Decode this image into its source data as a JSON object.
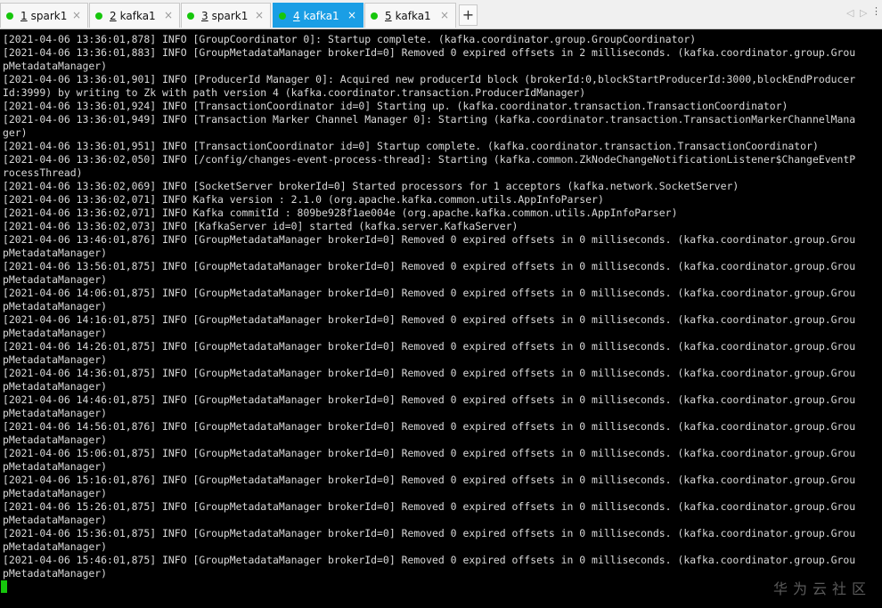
{
  "tabs": [
    {
      "num": "1",
      "name": "spark1",
      "close": "×"
    },
    {
      "num": "2",
      "name": "kafka1",
      "close": "×"
    },
    {
      "num": "3",
      "name": "spark1",
      "close": "×"
    },
    {
      "num": "4",
      "name": "kafka1",
      "close": "×"
    },
    {
      "num": "5",
      "name": "kafka1",
      "close": "×"
    }
  ],
  "add_tab": "+",
  "nav": {
    "left": "◁",
    "right": "▷",
    "menu": "⋮"
  },
  "terminal_lines": [
    "[2021-04-06 13:36:01,878] INFO [GroupCoordinator 0]: Startup complete. (kafka.coordinator.group.GroupCoordinator)",
    "[2021-04-06 13:36:01,883] INFO [GroupMetadataManager brokerId=0] Removed 0 expired offsets in 2 milliseconds. (kafka.coordinator.group.Grou",
    "pMetadataManager)",
    "[2021-04-06 13:36:01,901] INFO [ProducerId Manager 0]: Acquired new producerId block (brokerId:0,blockStartProducerId:3000,blockEndProducer",
    "Id:3999) by writing to Zk with path version 4 (kafka.coordinator.transaction.ProducerIdManager)",
    "[2021-04-06 13:36:01,924] INFO [TransactionCoordinator id=0] Starting up. (kafka.coordinator.transaction.TransactionCoordinator)",
    "[2021-04-06 13:36:01,949] INFO [Transaction Marker Channel Manager 0]: Starting (kafka.coordinator.transaction.TransactionMarkerChannelMana",
    "ger)",
    "[2021-04-06 13:36:01,951] INFO [TransactionCoordinator id=0] Startup complete. (kafka.coordinator.transaction.TransactionCoordinator)",
    "[2021-04-06 13:36:02,050] INFO [/config/changes-event-process-thread]: Starting (kafka.common.ZkNodeChangeNotificationListener$ChangeEventP",
    "rocessThread)",
    "[2021-04-06 13:36:02,069] INFO [SocketServer brokerId=0] Started processors for 1 acceptors (kafka.network.SocketServer)",
    "[2021-04-06 13:36:02,071] INFO Kafka version : 2.1.0 (org.apache.kafka.common.utils.AppInfoParser)",
    "[2021-04-06 13:36:02,071] INFO Kafka commitId : 809be928f1ae004e (org.apache.kafka.common.utils.AppInfoParser)",
    "[2021-04-06 13:36:02,073] INFO [KafkaServer id=0] started (kafka.server.KafkaServer)",
    "[2021-04-06 13:46:01,876] INFO [GroupMetadataManager brokerId=0] Removed 0 expired offsets in 0 milliseconds. (kafka.coordinator.group.Grou",
    "pMetadataManager)",
    "[2021-04-06 13:56:01,875] INFO [GroupMetadataManager brokerId=0] Removed 0 expired offsets in 0 milliseconds. (kafka.coordinator.group.Grou",
    "pMetadataManager)",
    "[2021-04-06 14:06:01,875] INFO [GroupMetadataManager brokerId=0] Removed 0 expired offsets in 0 milliseconds. (kafka.coordinator.group.Grou",
    "pMetadataManager)",
    "[2021-04-06 14:16:01,875] INFO [GroupMetadataManager brokerId=0] Removed 0 expired offsets in 0 milliseconds. (kafka.coordinator.group.Grou",
    "pMetadataManager)",
    "[2021-04-06 14:26:01,875] INFO [GroupMetadataManager brokerId=0] Removed 0 expired offsets in 0 milliseconds. (kafka.coordinator.group.Grou",
    "pMetadataManager)",
    "[2021-04-06 14:36:01,875] INFO [GroupMetadataManager brokerId=0] Removed 0 expired offsets in 0 milliseconds. (kafka.coordinator.group.Grou",
    "pMetadataManager)",
    "[2021-04-06 14:46:01,875] INFO [GroupMetadataManager brokerId=0] Removed 0 expired offsets in 0 milliseconds. (kafka.coordinator.group.Grou",
    "pMetadataManager)",
    "[2021-04-06 14:56:01,876] INFO [GroupMetadataManager brokerId=0] Removed 0 expired offsets in 0 milliseconds. (kafka.coordinator.group.Grou",
    "pMetadataManager)",
    "[2021-04-06 15:06:01,875] INFO [GroupMetadataManager brokerId=0] Removed 0 expired offsets in 0 milliseconds. (kafka.coordinator.group.Grou",
    "pMetadataManager)",
    "[2021-04-06 15:16:01,876] INFO [GroupMetadataManager brokerId=0] Removed 0 expired offsets in 0 milliseconds. (kafka.coordinator.group.Grou",
    "pMetadataManager)",
    "[2021-04-06 15:26:01,875] INFO [GroupMetadataManager brokerId=0] Removed 0 expired offsets in 0 milliseconds. (kafka.coordinator.group.Grou",
    "pMetadataManager)",
    "[2021-04-06 15:36:01,875] INFO [GroupMetadataManager brokerId=0] Removed 0 expired offsets in 0 milliseconds. (kafka.coordinator.group.Grou",
    "pMetadataManager)",
    "[2021-04-06 15:46:01,875] INFO [GroupMetadataManager brokerId=0] Removed 0 expired offsets in 0 milliseconds. (kafka.coordinator.group.Grou",
    "pMetadataManager)"
  ],
  "watermark": "华为云社区",
  "colors": {
    "active_tab": "#1a9ee5",
    "status_dot": "#16c60c",
    "terminal_bg": "#000000",
    "terminal_fg": "#d9d9d9",
    "cursor": "#16c60c"
  }
}
